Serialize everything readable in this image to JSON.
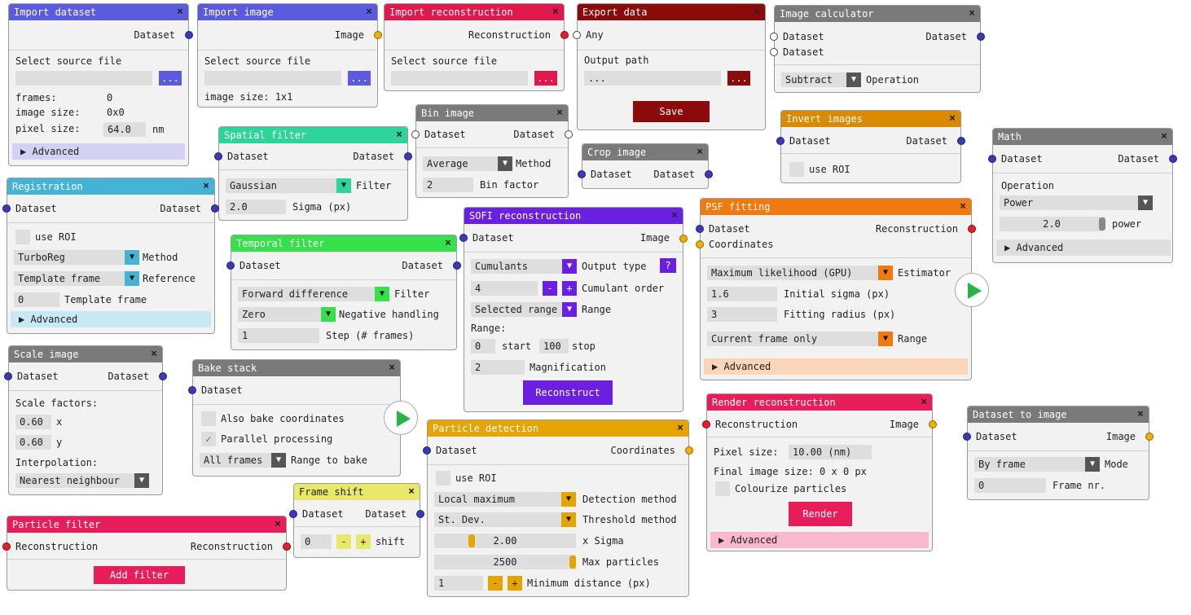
{
  "colors": {
    "import_dataset": "#5b5be0",
    "import_image": "#5b5be0",
    "import_recon": "#e0184c",
    "export": "#8b0a0a",
    "calc": "#7a7a7a",
    "spatial": "#2fd49a",
    "bin": "#7a7a7a",
    "crop": "#7a7a7a",
    "invert": "#d98a00",
    "math": "#7a7a7a",
    "registration": "#44b3d6",
    "temporal": "#35e04a",
    "sofi": "#6b1fe0",
    "psf": "#f07a10",
    "scale": "#7a7a7a",
    "bake": "#7a7a7a",
    "particle_detection": "#e6a400",
    "frame_shift": "#e8e86a",
    "particle_filter": "#e81e5a",
    "render": "#e81e5a",
    "dataset_to_image": "#7a7a7a"
  },
  "import_dataset": {
    "title": "Import dataset",
    "out": "Dataset",
    "select": "Select source file",
    "browse": "...",
    "frames_l": "frames:",
    "frames_v": "0",
    "size_l": "image size:",
    "size_v": "0x0",
    "pix_l": "pixel size:",
    "pix_v": "64.0",
    "pix_u": "nm",
    "adv": "Advanced"
  },
  "import_image": {
    "title": "Import image",
    "out": "Image",
    "select": "Select source file",
    "browse": "...",
    "size": "image size: 1x1"
  },
  "import_recon": {
    "title": "Import reconstruction",
    "out": "Reconstruction",
    "select": "Select source file",
    "browse": "..."
  },
  "export": {
    "title": "Export data",
    "in": "Any",
    "path_l": "Output path",
    "path_v": "...",
    "browse": "...",
    "save": "Save"
  },
  "calc": {
    "title": "Image calculator",
    "in1": "Dataset",
    "in2": "Dataset",
    "out": "Dataset",
    "op_v": "Subtract",
    "op_l": "Operation"
  },
  "spatial": {
    "title": "Spatial filter",
    "in": "Dataset",
    "out": "Dataset",
    "filter_v": "Gaussian",
    "filter_l": "Filter",
    "sigma_v": "2.0",
    "sigma_l": "Sigma (px)"
  },
  "bin": {
    "title": "Bin image",
    "in": "Dataset",
    "out": "Dataset",
    "method_v": "Average",
    "method_l": "Method",
    "factor_v": "2",
    "factor_l": "Bin factor"
  },
  "crop": {
    "title": "Crop image",
    "in": "Dataset",
    "out": "Dataset"
  },
  "invert": {
    "title": "Invert images",
    "in": "Dataset",
    "out": "Dataset",
    "roi": "use ROI"
  },
  "math": {
    "title": "Math",
    "in": "Dataset",
    "out": "Dataset",
    "op_l": "Operation",
    "op_v": "Power",
    "val": "2.0",
    "val_l": "power",
    "adv": "Advanced"
  },
  "registration": {
    "title": "Registration",
    "in": "Dataset",
    "out": "Dataset",
    "roi": "use ROI",
    "method_v": "TurboReg",
    "method_l": "Method",
    "ref_v": "Template frame",
    "ref_l": "Reference",
    "tf_v": "0",
    "tf_l": "Template frame",
    "adv": "Advanced"
  },
  "temporal": {
    "title": "Temporal filter",
    "in": "Dataset",
    "out": "Dataset",
    "filter_v": "Forward difference",
    "filter_l": "Filter",
    "neg_v": "Zero",
    "neg_l": "Negative handling",
    "step_v": "1",
    "step_l": "Step (# frames)"
  },
  "sofi": {
    "title": "SOFI reconstruction",
    "in": "Dataset",
    "out": "Image",
    "type_v": "Cumulants",
    "type_l": "Output type",
    "help": "?",
    "order_v": "4",
    "order_l": "Cumulant order",
    "range_v": "Selected range",
    "range_l": "Range",
    "range_h": "Range:",
    "start_v": "0",
    "start_l": "start",
    "stop_v": "100",
    "stop_l": "stop",
    "mag_v": "2",
    "mag_l": "Magnification",
    "btn": "Reconstruct",
    "minus": "-",
    "plus": "+"
  },
  "psf": {
    "title": "PSF fitting",
    "in1": "Dataset",
    "in2": "Coordinates",
    "out": "Reconstruction",
    "est_v": "Maximum likelihood (GPU)",
    "est_l": "Estimator",
    "sig_v": "1.6",
    "sig_l": "Initial sigma (px)",
    "rad_v": "3",
    "rad_l": "Fitting radius (px)",
    "range_v": "Current frame only",
    "range_l": "Range",
    "adv": "Advanced"
  },
  "scale": {
    "title": "Scale image",
    "in": "Dataset",
    "out": "Dataset",
    "factors": "Scale factors:",
    "x_v": "0.60",
    "x_l": "x",
    "y_v": "0.60",
    "y_l": "y",
    "interp": "Interpolation:",
    "interp_v": "Nearest neighbour"
  },
  "bake": {
    "title": "Bake stack",
    "in": "Dataset",
    "coords": "Also bake coordinates",
    "parallel": "Parallel processing",
    "check": "✓",
    "range_v": "All frames",
    "range_l": "Range to bake"
  },
  "particle_detection": {
    "title": "Particle detection",
    "in": "Dataset",
    "out": "Coordinates",
    "roi": "use ROI",
    "det_v": "Local maximum",
    "det_l": "Detection method",
    "thr_v": "St. Dev.",
    "thr_l": "Threshold method",
    "sig_v": "2.00",
    "sig_l": "x Sigma",
    "max_v": "2500",
    "max_l": "Max particles",
    "min_v": "1",
    "min_l": "Minimum distance (px)",
    "minus": "-",
    "plus": "+"
  },
  "frame_shift": {
    "title": "Frame shift",
    "in": "Dataset",
    "out": "Dataset",
    "v": "0",
    "l": "shift",
    "minus": "-",
    "plus": "+"
  },
  "particle_filter": {
    "title": "Particle filter",
    "in": "Reconstruction",
    "out": "Reconstruction",
    "btn": "Add filter"
  },
  "render": {
    "title": "Render reconstruction",
    "in": "Reconstruction",
    "out": "Image",
    "pix_l": "Pixel size:",
    "pix_v": "10.00 (nm)",
    "final": "Final image size: 0 x 0 px",
    "colour": "Colourize particles",
    "btn": "Render",
    "adv": "Advanced"
  },
  "dataset_to_image": {
    "title": "Dataset to image",
    "in": "Dataset",
    "out": "Image",
    "mode_v": "By frame",
    "mode_l": "Mode",
    "frame_v": "0",
    "frame_l": "Frame nr."
  },
  "icons": {
    "close": "×",
    "dropdown": "▼",
    "advanced": "▶"
  }
}
